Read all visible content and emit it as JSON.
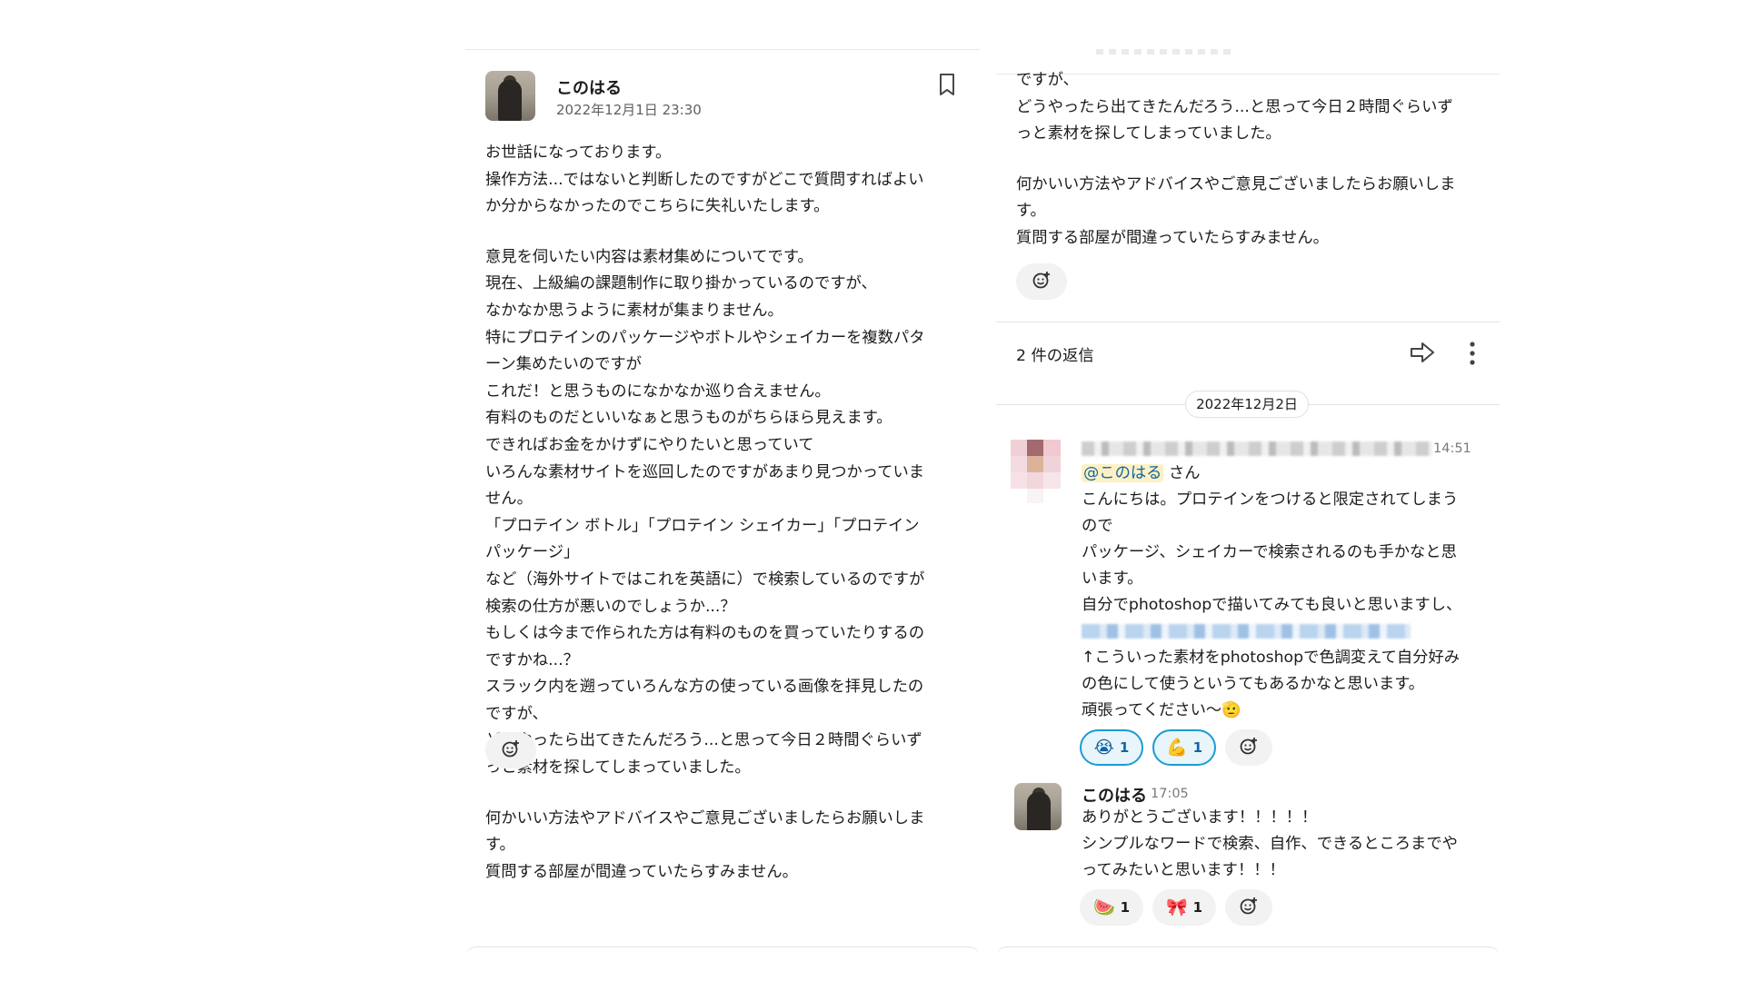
{
  "post": {
    "user": "このはる",
    "timestamp": "2022年12月1日 23:30",
    "body_lines": [
      "お世話になっております。",
      "操作方法...ではないと判断したのですがどこで質問すればよい",
      "か分からなかったのでこちらに失礼いたします。",
      "",
      "意見を伺いたい内容は素材集めについてです。",
      "現在、上級編の課題制作に取り掛かっているのですが、",
      "なかなか思うように素材が集まりません。",
      "特にプロテインのパッケージやボトルやシェイカーを複数パタ",
      "ーン集めたいのですが",
      "これだ！と思うものになかなか巡り合えません。",
      "有料のものだといいなぁと思うものがちらほら見えます。",
      "できればお金をかけずにやりたいと思っていて",
      "いろんな素材サイトを巡回したのですがあまり見つかっていま",
      "せん。",
      "「プロテイン ボトル」「プロテイン シェイカー」「プロテイン",
      "パッケージ」",
      "など（海外サイトではこれを英語に）で検索しているのですが",
      "検索の仕方が悪いのでしょうか...？",
      "もしくは今まで作られた方は有料のものを買っていたりするの",
      "ですかね...？",
      "スラック内を遡っていろんな方の使っている画像を拝見したの",
      "ですが、",
      "どうやったら出てきたんだろう...と思って今日２時間ぐらいず",
      "っと素材を探してしまっていました。",
      "",
      "何かいい方法やアドバイスやご意見ございましたらお願いしま",
      "す。",
      "質問する部屋が間違っていたらすみません。"
    ]
  },
  "thread": {
    "tail_lines": [
      "ですが、",
      "どうやったら出てきたんだろう...と思って今日２時間ぐらいず",
      "っと素材を探してしまっていました。",
      "",
      "何かいい方法やアドバイスやご意見ございましたらお願いしま",
      "す。",
      "質問する部屋が間違っていたらすみません。"
    ],
    "replies_label": "2 件の返信",
    "date_divider": "2022年12月2日",
    "reply1": {
      "time": "14:51",
      "mention": "@このはる",
      "mention_suffix": " さん",
      "lines_a": [
        "こんにちは。プロテインをつけると限定されてしまう",
        "ので",
        "パッケージ、シェイカーで検索されるのも手かなと思",
        "います。",
        "自分でphotoshopで描いてみても良いと思いますし、"
      ],
      "lines_b": [
        "↑こういった素材をphotoshopで色調変えて自分好み",
        "の色にして使うというてもあるかなと思います。",
        "頑張ってください〜🫡"
      ],
      "reactions": [
        {
          "emoji": "😭",
          "count": "1"
        },
        {
          "emoji": "💪",
          "count": "1"
        }
      ]
    },
    "reply2": {
      "user": "このはる",
      "time": "17:05",
      "lines": [
        "ありがとうございます！！！！！",
        "シンプルなワードで検索、自作、できるところまでや",
        "ってみたいと思います！！！"
      ],
      "reactions": [
        {
          "emoji": "🍉",
          "count": "1"
        },
        {
          "emoji": "🎀",
          "count": "1"
        }
      ]
    }
  },
  "icons": {
    "bookmark": "bookmark-icon",
    "add_reaction": "add-reaction-icon",
    "share": "share-arrow-icon",
    "more": "more-vertical-icon"
  },
  "colors": {
    "reaction_active_border": "#1d9bd1",
    "mention_bg": "#fdf1c4",
    "mention_text": "#1264a3"
  }
}
